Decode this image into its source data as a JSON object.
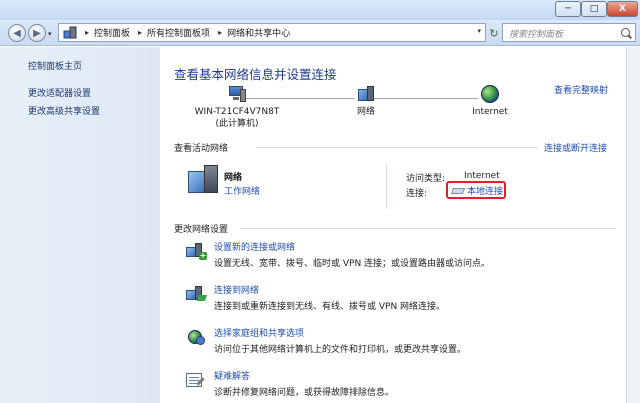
{
  "window": {
    "min_glyph": "─",
    "max_glyph": "□",
    "close_glyph": "X"
  },
  "toolbar": {
    "back_glyph": "◀",
    "forward_glyph": "▶",
    "history_glyph": "▾",
    "breadcrumbs": [
      "控制面板",
      "所有控制面板项",
      "网络和共享中心"
    ],
    "separator_glyph": "▸",
    "dropdown_glyph": "▾",
    "refresh_glyph": "↻",
    "search_placeholder": "搜索控制面板"
  },
  "left_pane": {
    "home": "控制面板主页",
    "adapter": "更改适配器设置",
    "sharing": "更改高级共享设置"
  },
  "main": {
    "title": "查看基本网络信息并设置连接",
    "full_map": "查看完整映射",
    "map_nodes": {
      "pc_name": "WIN-T21CF4V7N8T",
      "pc_sub": "(此计算机)",
      "network": "网络",
      "internet": "Internet"
    },
    "active_title": "查看活动网络",
    "connect_toggle": "连接或断开连接",
    "active_network": {
      "name": "网络",
      "type": "工作网络",
      "access_label": "访问类型:",
      "access_value": "Internet",
      "conn_label": "连接:",
      "conn_value": "本地连接"
    },
    "change_title": "更改网络设置",
    "tasks": [
      {
        "title": "设置新的连接或网络",
        "desc": "设置无线、宽带、拨号、临时或 VPN 连接；或设置路由器或访问点。"
      },
      {
        "title": "连接到网络",
        "desc": "连接到或重新连接到无线、有线、拨号或 VPN 网络连接。"
      },
      {
        "title": "选择家庭组和共享选项",
        "desc": "访问位于其他网络计算机上的文件和打印机，或更改共享设置。"
      },
      {
        "title": "疑难解答",
        "desc": "诊断并修复网络问题，或获得故障排除信息。"
      }
    ]
  }
}
